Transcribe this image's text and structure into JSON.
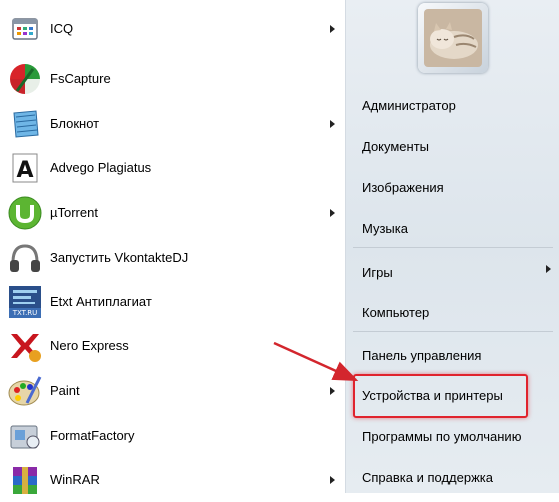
{
  "left_programs": [
    {
      "label": "ICQ",
      "icon": "icq-icon",
      "submenu": true
    },
    {
      "label": "FsCapture",
      "icon": "fscapture-icon",
      "submenu": false
    },
    {
      "label": "Блокнот",
      "icon": "notepad-icon",
      "submenu": true
    },
    {
      "label": "Advego Plagiatus",
      "icon": "advego-icon",
      "submenu": false
    },
    {
      "label": "µTorrent",
      "icon": "utorrent-icon",
      "submenu": true
    },
    {
      "label": "Запустить VkontakteDJ",
      "icon": "headphones-icon",
      "submenu": false
    },
    {
      "label": "Etxt Антиплагиат",
      "icon": "etxt-icon",
      "submenu": false
    },
    {
      "label": "Nero Express",
      "icon": "nero-icon",
      "submenu": false
    },
    {
      "label": "Paint",
      "icon": "paint-icon",
      "submenu": true
    },
    {
      "label": "FormatFactory",
      "icon": "formatfactory-icon",
      "submenu": false
    },
    {
      "label": "WinRAR",
      "icon": "winrar-icon",
      "submenu": true
    }
  ],
  "etxt_icon_text": "TXT.RU",
  "right_items": [
    {
      "label": "Администратор",
      "submenu": false
    },
    {
      "label": "Документы",
      "submenu": false
    },
    {
      "label": "Изображения",
      "submenu": false
    },
    {
      "label": "Музыка",
      "submenu": false
    },
    {
      "label": "Игры",
      "submenu": true
    },
    {
      "label": "Компьютер",
      "submenu": false
    },
    {
      "label": "Панель управления",
      "submenu": false
    },
    {
      "label": "Устройства и принтеры",
      "submenu": false
    },
    {
      "label": "Программы по умолчанию",
      "submenu": false
    },
    {
      "label": "Справка и поддержка",
      "submenu": false
    }
  ],
  "colors": {
    "highlight": "#e0232d",
    "right_panel": "#e3e9ef"
  }
}
